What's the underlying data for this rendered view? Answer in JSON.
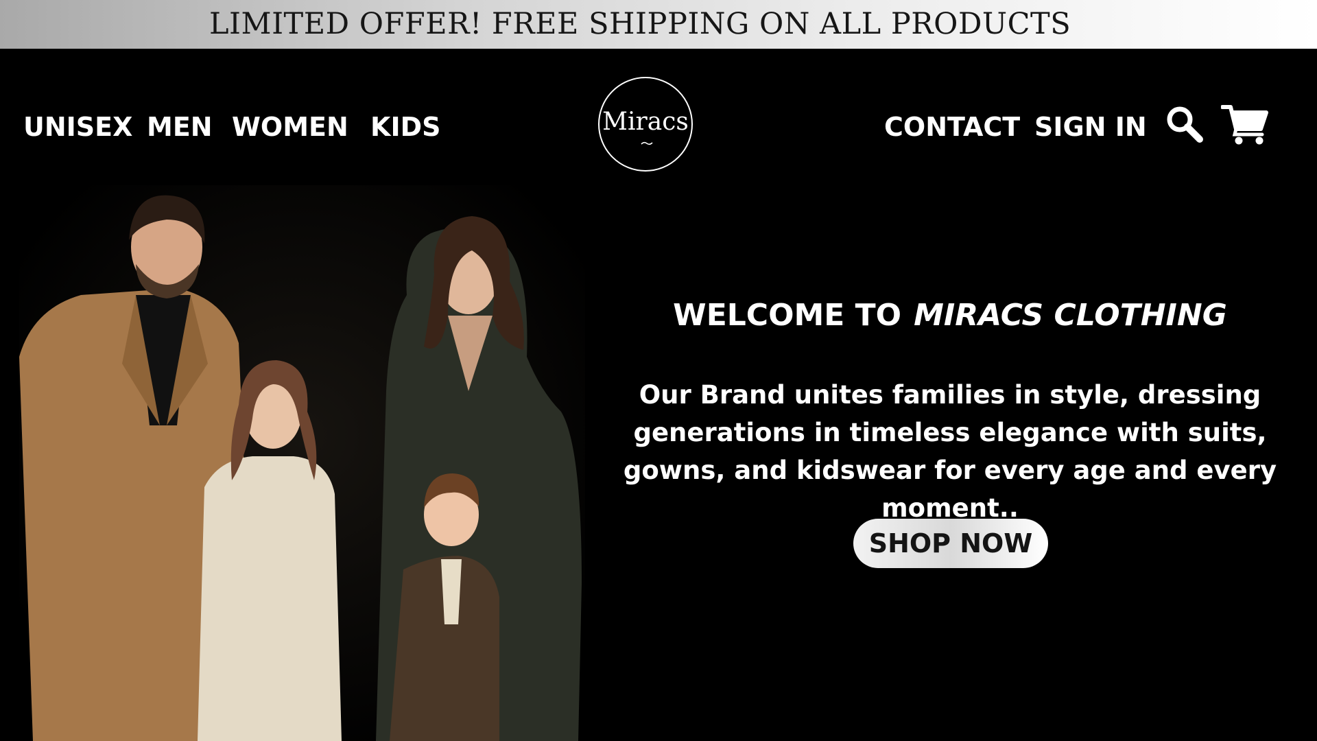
{
  "promo": {
    "text": "LIMITED OFFER!  FREE SHIPPING ON ALL PRODUCTS"
  },
  "nav_left": {
    "unisex": "UNISEX",
    "men": "MEN",
    "women": "WOMEN",
    "kids": "KIDS"
  },
  "logo": {
    "text": "Miracs"
  },
  "nav_right": {
    "contact": "CONTACT",
    "sign_in": "SIGN IN"
  },
  "icons": {
    "search": "search-icon",
    "cart": "cart-icon"
  },
  "hero": {
    "heading_prefix": "WELCOME TO",
    "heading_brand": "MIRACS CLOTHING",
    "body": "Our Brand unites families in style, dressing generations in timeless elegance with suits, gowns, and kidswear for every age and every moment..",
    "cta": "SHOP NOW"
  },
  "colors": {
    "background": "#000000",
    "text": "#ffffff",
    "promo_text": "#161616",
    "suit": "#a6784a",
    "dress_cream": "#e4dac6",
    "dress_green": "#2b2f26",
    "boy_jacket": "#4a3727"
  }
}
